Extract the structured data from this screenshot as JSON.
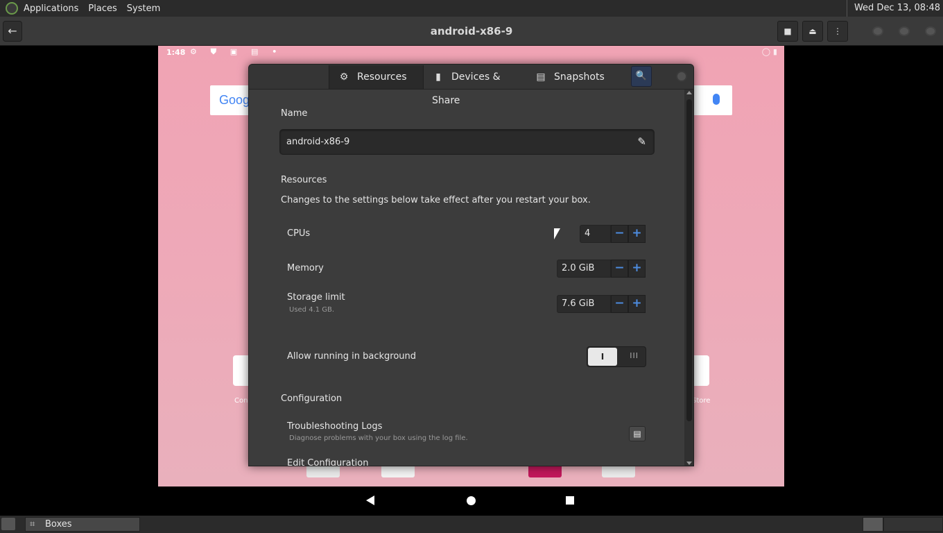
{
  "top_panel": {
    "menus": [
      "Applications",
      "Places",
      "System"
    ],
    "clock": "Wed Dec 13, 08:48"
  },
  "headerbar": {
    "back_icon": "←",
    "title": "android-x86-9"
  },
  "android": {
    "status_time": "1:48",
    "status_icons": "⚙ ⛊ ▣ ▤ •",
    "status_right": "◯ ▮",
    "google_text": "Goog",
    "label_left": "Con",
    "label_right": "Store"
  },
  "dialog": {
    "tabs": [
      {
        "icon": "⚙",
        "label": "Resources"
      },
      {
        "icon": "▮",
        "label": "Devices & Share"
      },
      {
        "icon": "▤",
        "label": "Snapshots"
      }
    ],
    "search_icon": "🔍",
    "name_label": "Name",
    "name_value": "android-x86-9",
    "edit_icon": "✎",
    "resources_label": "Resources",
    "resources_note": "Changes to the settings below take effect after you restart your box.",
    "cpus": {
      "label": "CPUs",
      "value": "4"
    },
    "memory": {
      "label": "Memory",
      "value": "2.0 GiB"
    },
    "storage": {
      "label": "Storage limit",
      "value": "7.6 GiB",
      "sub": "Used 4.1 GB."
    },
    "minus": "−",
    "plus": "+",
    "background": {
      "label": "Allow running in background",
      "on_glyph": "I",
      "off_glyph": "III",
      "state": "on"
    },
    "configuration_label": "Configuration",
    "logs": {
      "label": "Troubleshooting Logs",
      "sub": "Diagnose problems with your box using the log file.",
      "icon": "▤"
    },
    "edit_config_label": "Edit Configuration"
  },
  "taskbar": {
    "task_label": "Boxes",
    "task_icon": "⌗"
  }
}
